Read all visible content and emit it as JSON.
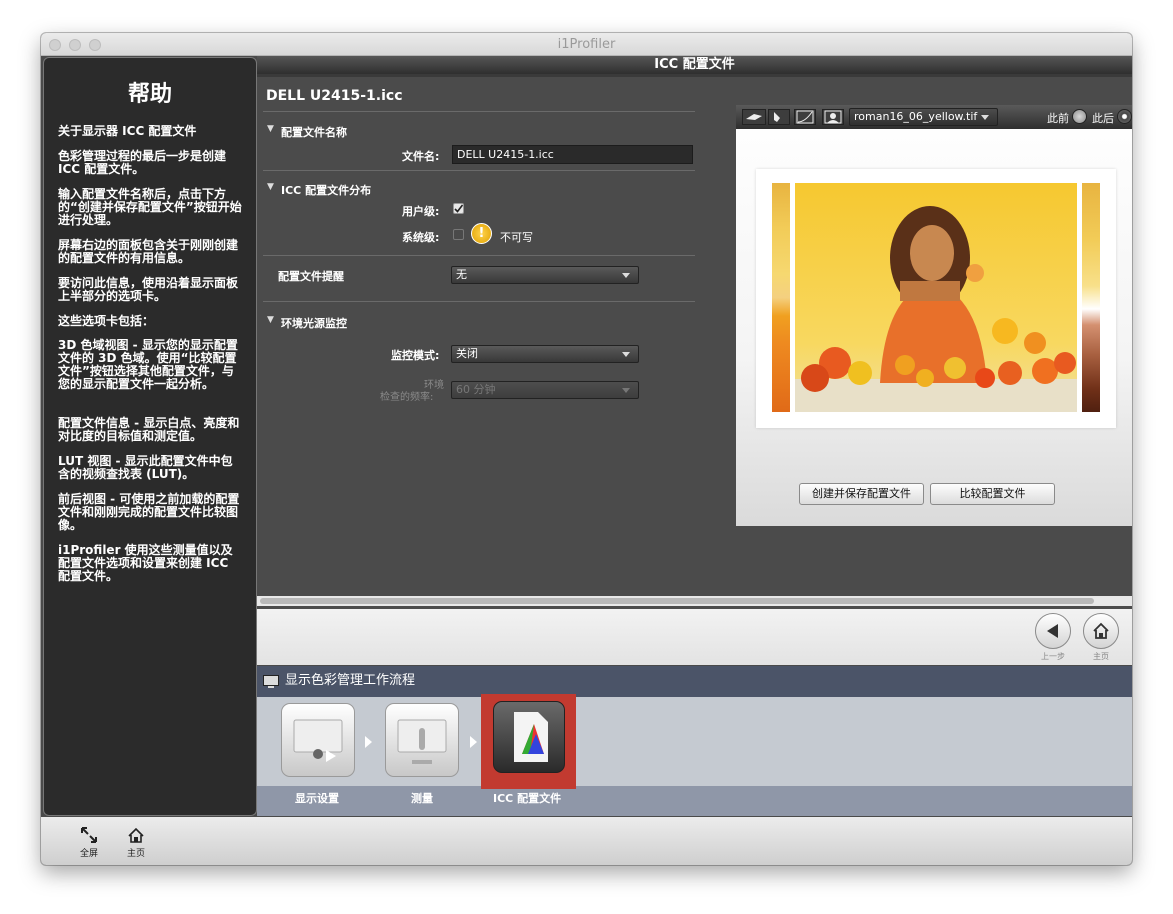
{
  "window": {
    "title": "i1Profiler"
  },
  "help": {
    "title": "帮助",
    "paragraphs": [
      "关于显示器 ICC 配置文件",
      "色彩管理过程的最后一步是创建 ICC 配置文件。",
      "输入配置文件名称后，点击下方的“创建并保存配置文件”按钮开始进行处理。",
      "屏幕右边的面板包含关于刚刚创建的配置文件的有用信息。",
      "要访问此信息，使用沿着显示面板上半部分的选项卡。",
      "这些选项卡包括：",
      "3D 色域视图 - 显示您的显示配置文件的 3D 色域。使用“比较配置文件”按钮选择其他配置文件，与您的显示配置文件一起分析。",
      "配置文件信息 - 显示白点、亮度和对比度的目标值和测定值。",
      "LUT 视图 - 显示此配置文件中包含的视频查找表 (LUT)。",
      "前后视图 - 可使用之前加载的配置文件和刚刚完成的配置文件比较图像。",
      "i1Profiler 使用这些测量值以及配置文件选项和设置来创建 ICC 配置文件。"
    ]
  },
  "main": {
    "header": "ICC 配置文件",
    "profile_name": "DELL U2415-1.icc",
    "section_name": {
      "title": "配置文件名称",
      "field_label": "文件名:",
      "field_value": "DELL U2415-1.icc"
    },
    "section_dist": {
      "title": "ICC 配置文件分布",
      "user_label": "用户级:",
      "user_checked": true,
      "system_label": "系统级:",
      "system_checked": false,
      "warning": "不可写"
    },
    "reminder": {
      "label": "配置文件提醒",
      "value": "无"
    },
    "ambient": {
      "title": "环境光源监控",
      "mode_label": "监控模式:",
      "mode_value": "关闭",
      "freq_label_1": "环境",
      "freq_label_2": "检查的频率:",
      "freq_value": "60 分钟"
    }
  },
  "preview": {
    "image_select": "roman16_06_yellow.tif",
    "before_label": "此前",
    "after_label": "此后",
    "create_button": "创建并保存配置文件",
    "compare_button": "比较配置文件"
  },
  "nav": {
    "back": "上一步",
    "home": "主页"
  },
  "workflow": {
    "title": "显示色彩管理工作流程",
    "steps": [
      "显示设置",
      "测量",
      "ICC 配置文件"
    ]
  },
  "footer": {
    "fullscreen": "全屏",
    "home": "主页"
  }
}
